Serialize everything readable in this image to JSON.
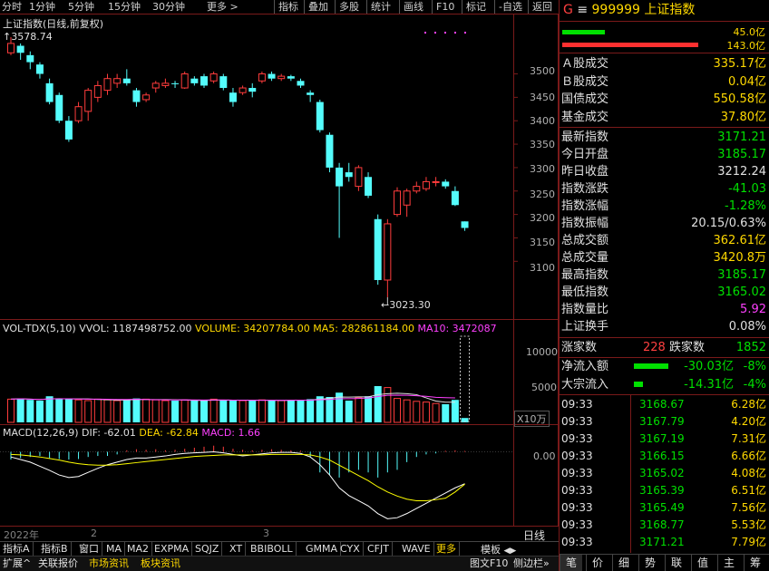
{
  "toolbar": {
    "left_items": [
      "分时",
      "1分钟",
      "5分钟",
      "15分钟",
      "30分钟",
      "更多 >"
    ],
    "right_items": [
      "指标",
      "叠加",
      "多股",
      "统计",
      "画线",
      "F10",
      "标记",
      "-自选",
      "返回"
    ]
  },
  "chart": {
    "title": "上证指数(日线,前复权)",
    "high_label": "3578.74",
    "low_label": "3023.30",
    "price_ticks": [
      "3500",
      "3450",
      "3400",
      "3350",
      "3300",
      "3250",
      "3200",
      "3150",
      "3100"
    ],
    "vol_header": {
      "name": "VOL-TDX(5,10)",
      "vvol": "VVOL: 1187498752.00",
      "volume": "VOLUME: 34207784.00",
      "ma5": "MA5: 282861184.00",
      "ma10": "MA10: 3472087"
    },
    "vol_ticks": [
      "10000",
      "5000"
    ],
    "vol_unit": "X10万",
    "macd_header": {
      "name": "MACD(12,26,9)",
      "dif": "DIF: -62.01",
      "dea": "DEA: -62.84",
      "macd": "MACD: 1.66"
    },
    "macd_ticks": [
      "0.00"
    ],
    "date_labels": [
      "2022年",
      "2",
      "3"
    ],
    "period_label": "日线",
    "colors": {
      "up": "#ff3c3c",
      "down": "#54fcfc",
      "grid": "#7a1a1a"
    }
  },
  "chart_data": {
    "type": "candlestick",
    "title": "上证指数(日线,前复权)",
    "candles": [
      {
        "o": 3545,
        "c": 3565,
        "h": 3578.74,
        "l": 3540
      },
      {
        "o": 3560,
        "c": 3545,
        "h": 3565,
        "l": 3530
      },
      {
        "o": 3540,
        "c": 3525,
        "h": 3548,
        "l": 3510
      },
      {
        "o": 3520,
        "c": 3500,
        "h": 3525,
        "l": 3490
      },
      {
        "o": 3480,
        "c": 3440,
        "h": 3490,
        "l": 3435
      },
      {
        "o": 3455,
        "c": 3400,
        "h": 3460,
        "l": 3395
      },
      {
        "o": 3400,
        "c": 3360,
        "h": 3410,
        "l": 3355
      },
      {
        "o": 3400,
        "c": 3430,
        "h": 3440,
        "l": 3395
      },
      {
        "o": 3420,
        "c": 3465,
        "h": 3470,
        "l": 3400
      },
      {
        "o": 3450,
        "c": 3475,
        "h": 3485,
        "l": 3440
      },
      {
        "o": 3465,
        "c": 3490,
        "h": 3500,
        "l": 3455
      },
      {
        "o": 3480,
        "c": 3490,
        "h": 3500,
        "l": 3470
      },
      {
        "o": 3490,
        "c": 3480,
        "h": 3510,
        "l": 3475
      },
      {
        "o": 3465,
        "c": 3440,
        "h": 3470,
        "l": 3430
      },
      {
        "o": 3445,
        "c": 3455,
        "h": 3460,
        "l": 3440
      },
      {
        "o": 3470,
        "c": 3480,
        "h": 3485,
        "l": 3460
      },
      {
        "o": 3475,
        "c": 3480,
        "h": 3490,
        "l": 3470
      },
      {
        "o": 3480,
        "c": 3478,
        "h": 3485,
        "l": 3470
      },
      {
        "o": 3470,
        "c": 3500,
        "h": 3505,
        "l": 3468
      },
      {
        "o": 3490,
        "c": 3480,
        "h": 3495,
        "l": 3475
      },
      {
        "o": 3495,
        "c": 3475,
        "h": 3500,
        "l": 3470
      },
      {
        "o": 3485,
        "c": 3500,
        "h": 3505,
        "l": 3480
      },
      {
        "o": 3495,
        "c": 3470,
        "h": 3500,
        "l": 3465
      },
      {
        "o": 3460,
        "c": 3440,
        "h": 3470,
        "l": 3430
      },
      {
        "o": 3460,
        "c": 3470,
        "h": 3475,
        "l": 3455
      },
      {
        "o": 3470,
        "c": 3462,
        "h": 3480,
        "l": 3450
      },
      {
        "o": 3485,
        "c": 3500,
        "h": 3505,
        "l": 3480
      },
      {
        "o": 3500,
        "c": 3490,
        "h": 3505,
        "l": 3485
      },
      {
        "o": 3490,
        "c": 3495,
        "h": 3500,
        "l": 3485
      },
      {
        "o": 3495,
        "c": 3490,
        "h": 3498,
        "l": 3485
      },
      {
        "o": 3485,
        "c": 3475,
        "h": 3490,
        "l": 3470
      },
      {
        "o": 3460,
        "c": 3455,
        "h": 3465,
        "l": 3440
      },
      {
        "o": 3440,
        "c": 3380,
        "h": 3445,
        "l": 3375
      },
      {
        "o": 3370,
        "c": 3300,
        "h": 3375,
        "l": 3290
      },
      {
        "o": 3300,
        "c": 3260,
        "h": 3310,
        "l": 3150
      },
      {
        "o": 3290,
        "c": 3280,
        "h": 3310,
        "l": 3270
      },
      {
        "o": 3260,
        "c": 3300,
        "h": 3305,
        "l": 3250
      },
      {
        "o": 3280,
        "c": 3240,
        "h": 3290,
        "l": 3235
      },
      {
        "o": 3190,
        "c": 3060,
        "h": 3200,
        "l": 3050
      },
      {
        "o": 3060,
        "c": 3180,
        "h": 3190,
        "l": 3023.3
      },
      {
        "o": 3200,
        "c": 3250,
        "h": 3258,
        "l": 3195
      },
      {
        "o": 3220,
        "c": 3250,
        "h": 3255,
        "l": 3195
      },
      {
        "o": 3250,
        "c": 3260,
        "h": 3270,
        "l": 3245
      },
      {
        "o": 3255,
        "c": 3270,
        "h": 3280,
        "l": 3250
      },
      {
        "o": 3270,
        "c": 3270,
        "h": 3280,
        "l": 3260
      },
      {
        "o": 3270,
        "c": 3260,
        "h": 3275,
        "l": 3255
      },
      {
        "o": 3250,
        "c": 3220,
        "h": 3260,
        "l": 3218
      },
      {
        "o": 3185.17,
        "c": 3171.21,
        "h": 3185.17,
        "l": 3165.02
      }
    ],
    "ylim": [
      3000,
      3590
    ],
    "volume": [
      3200,
      3300,
      3100,
      3000,
      3600,
      3300,
      3200,
      3100,
      3000,
      3200,
      3100,
      3000,
      3100,
      3300,
      3200,
      3100,
      3000,
      3000,
      3100,
      3000,
      3000,
      3200,
      3000,
      3100,
      3000,
      3000,
      3100,
      3000,
      3000,
      3100,
      3100,
      3200,
      3600,
      3500,
      4100,
      3000,
      3400,
      3600,
      5000,
      4800,
      3300,
      3100,
      2900,
      2800,
      2600,
      2500,
      3100,
      600
    ],
    "volume_ylim": [
      0,
      12000
    ],
    "macd": [
      -15,
      -12,
      -10,
      -8,
      -12,
      -14,
      -15,
      -14,
      -10,
      -8,
      -8,
      -5,
      3,
      5,
      4,
      5,
      3,
      4,
      6,
      8,
      10,
      12,
      10,
      6,
      4,
      3,
      4,
      5,
      4,
      3,
      2,
      -10,
      -40,
      -45,
      -50,
      -40,
      -35,
      -40,
      -50,
      -40,
      -35,
      -20,
      -10,
      -5,
      -3,
      2,
      3,
      1.66
    ],
    "dif": [
      -10,
      -15,
      -20,
      -28,
      -36,
      -45,
      -50,
      -48,
      -40,
      -32,
      -25,
      -20,
      -15,
      -12,
      -12,
      -10,
      -8,
      -5,
      -3,
      -2,
      -1,
      0,
      -2,
      -5,
      -8,
      -6,
      -4,
      -2,
      -1,
      -1,
      -3,
      -10,
      -25,
      -45,
      -70,
      -85,
      -95,
      -105,
      -120,
      -130,
      -128,
      -120,
      -110,
      -100,
      -90,
      -80,
      -70,
      -62.01
    ],
    "dea": [
      -5,
      -6,
      -8,
      -10,
      -13,
      -16,
      -20,
      -23,
      -25,
      -26,
      -26,
      -25,
      -23,
      -21,
      -19,
      -17,
      -15,
      -13,
      -11,
      -9,
      -8,
      -7,
      -6,
      -6,
      -6,
      -6,
      -6,
      -5,
      -5,
      -5,
      -5,
      -6,
      -10,
      -16,
      -26,
      -36,
      -46,
      -56,
      -68,
      -78,
      -86,
      -92,
      -95,
      -95,
      -93,
      -90,
      -78,
      -62.84
    ]
  },
  "quote": {
    "code_prefix": "G",
    "menu_icon": "≡",
    "code": "999999",
    "name": "上证指数",
    "bar1_val": "45.0亿",
    "bar2_val": "143.0亿",
    "bar1_frac": 0.31,
    "bar2_frac": 1.0,
    "rows1": [
      {
        "label": "Ａ股成交",
        "value": "335.17亿",
        "color": "yel"
      },
      {
        "label": "Ｂ股成交",
        "value": "0.04亿",
        "color": "yel"
      },
      {
        "label": "国债成交",
        "value": "550.58亿",
        "color": "yel"
      },
      {
        "label": "基金成交",
        "value": "37.80亿",
        "color": "yel"
      }
    ],
    "rows2": [
      {
        "label": "最新指数",
        "value": "3171.21",
        "color": "green"
      },
      {
        "label": "今日开盘",
        "value": "3185.17",
        "color": "green"
      },
      {
        "label": "昨日收盘",
        "value": "3212.24",
        "color": "white"
      },
      {
        "label": "指数涨跌",
        "value": "-41.03",
        "color": "green"
      },
      {
        "label": "指数涨幅",
        "value": "-1.28%",
        "color": "green"
      },
      {
        "label": "指数振幅",
        "value": "20.15/0.63%",
        "color": "white"
      },
      {
        "label": "总成交额",
        "value": "362.61亿",
        "color": "yel"
      },
      {
        "label": "总成交量",
        "value": "3420.8万",
        "color": "yel"
      },
      {
        "label": "最高指数",
        "value": "3185.17",
        "color": "green"
      },
      {
        "label": "最低指数",
        "value": "3165.02",
        "color": "green"
      },
      {
        "label": "指数量比",
        "value": "5.92",
        "color": "mag"
      },
      {
        "label": "上证换手",
        "value": "0.08%",
        "color": "white"
      }
    ],
    "up_label": "涨家数",
    "up_count": "228",
    "down_label": "跌家数",
    "down_count": "1852",
    "flow": [
      {
        "label": "净流入额",
        "value": "-30.03亿",
        "pct": "-8%",
        "bar_frac": 0.8
      },
      {
        "label": "大宗流入",
        "value": "-14.31亿",
        "pct": "-4%",
        "bar_frac": 0.2
      }
    ],
    "ticks": [
      {
        "time": "09:33",
        "price": "3168.67",
        "vol": "6.28亿"
      },
      {
        "time": "09:33",
        "price": "3167.79",
        "vol": "4.20亿"
      },
      {
        "time": "09:33",
        "price": "3167.19",
        "vol": "7.31亿"
      },
      {
        "time": "09:33",
        "price": "3166.15",
        "vol": "6.66亿"
      },
      {
        "time": "09:33",
        "price": "3165.02",
        "vol": "4.08亿"
      },
      {
        "time": "09:33",
        "price": "3165.39",
        "vol": "6.51亿"
      },
      {
        "time": "09:33",
        "price": "3165.49",
        "vol": "7.56亿"
      },
      {
        "time": "09:33",
        "price": "3168.77",
        "vol": "5.53亿"
      },
      {
        "time": "09:33",
        "price": "3171.21",
        "vol": "7.79亿"
      }
    ]
  },
  "bottom_tabs": [
    "指标A",
    "指标B",
    "窗口",
    "MA",
    "MA2",
    "EXPMA",
    "SQJZ",
    "XT",
    "BBIBOLL",
    "GMMA",
    "CYX",
    "CFJT",
    "WAVE",
    "更多"
  ],
  "template_label": "模板",
  "status_tabs": [
    {
      "label": "扩展^",
      "color": "#e0e0e0"
    },
    {
      "label": "关联报价",
      "color": "#e0e0e0"
    },
    {
      "label": "市场资讯",
      "color": "#ffd900"
    },
    {
      "label": "板块资讯",
      "color": "#ffd900"
    }
  ],
  "status_right": "图文F10",
  "status_right2": "侧边栏»",
  "right_tabs": [
    "笔",
    "价",
    "细",
    "势",
    "联",
    "值",
    "主",
    "筹"
  ]
}
